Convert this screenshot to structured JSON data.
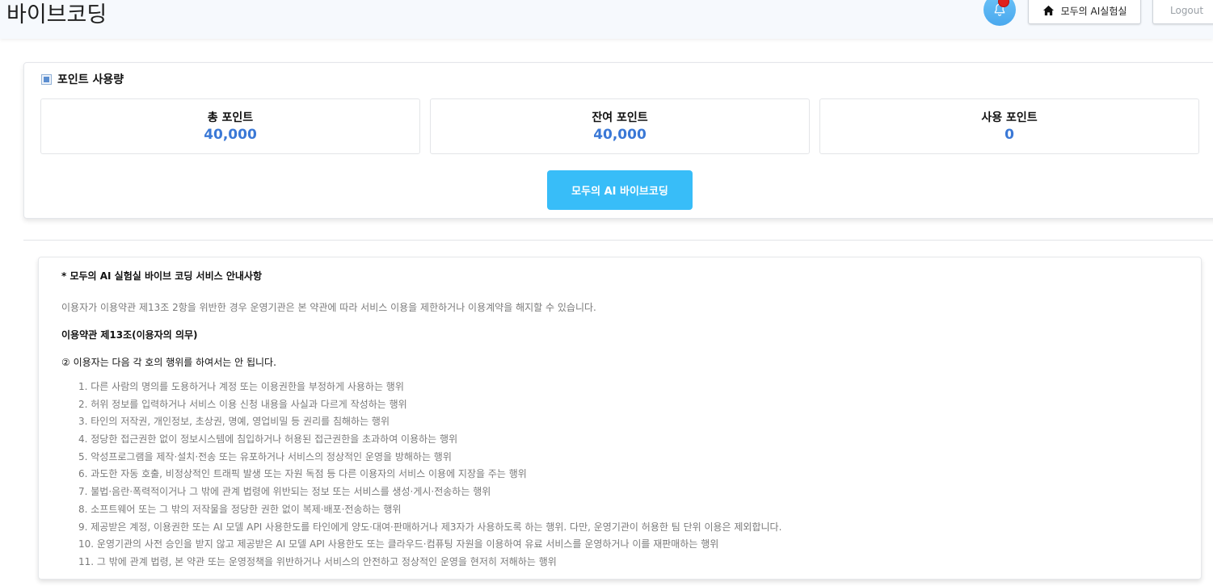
{
  "header": {
    "brand": "바이브코딩",
    "home_label": "모두의 AI실험실",
    "logout_label": "Logout"
  },
  "usage": {
    "title": "포인트 사용량",
    "stats": [
      {
        "label": "총 포인트",
        "value": "40,000"
      },
      {
        "label": "잔여 포인트",
        "value": "40,000"
      },
      {
        "label": "사용 포인트",
        "value": "0"
      }
    ],
    "cta_label": "모두의 AI 바이브코딩"
  },
  "notice": {
    "title": "* 모두의 AI 실험실 바이브 코딩 서비스 안내사항",
    "intro": "이용자가 이용약관 제13조 2항을 위반한 경우 운영기관은 본 약관에 따라 서비스 이용을 제한하거나 이용계약을 해지할 수 있습니다.",
    "subheading": "이용약관 제13조(이용자의 의무)",
    "lead": "② 이용자는 다음 각 호의 행위를 하여서는 안 됩니다.",
    "items": [
      "1. 다른 사람의 명의를 도용하거나 계정 또는 이용권한을 부정하게 사용하는 행위",
      "2. 허위 정보를 입력하거나 서비스 이용 신청 내용을 사실과 다르게 작성하는 행위",
      "3. 타인의 저작권, 개인정보, 초상권, 명예, 영업비밀 등 권리를 침해하는 행위",
      "4. 정당한 접근권한 없이 정보시스템에 침입하거나 허용된 접근권한을 초과하여 이용하는 행위",
      "5. 악성프로그램을 제작·설치·전송 또는 유포하거나 서비스의 정상적인 운영을 방해하는 행위",
      "6. 과도한 자동 호출, 비정상적인 트래픽 발생 또는 자원 독점 등 다른 이용자의 서비스 이용에 지장을 주는 행위",
      "7. 불법·음란·폭력적이거나 그 밖에 관계 법령에 위반되는 정보 또는 서비스를 생성·게시·전송하는 행위",
      "8. 소프트웨어 또는 그 밖의 저작물을 정당한 권한 없이 복제·배포·전송하는 행위",
      "9. 제공받은 계정, 이용권한 또는 AI 모델 API 사용한도를 타인에게 양도·대여·판매하거나 제3자가 사용하도록 하는 행위. 다만, 운영기관이 허용한 팀 단위 이용은 제외합니다.",
      "10. 운영기관의 사전 승인을 받지 않고 제공받은 AI 모델 API 사용한도 또는 클라우드·컴퓨팅 자원을 이용하여 유료 서비스를 운영하거나 이를 재판매하는 행위",
      "11. 그 밖에 관계 법령, 본 약관 또는 운영정책을 위반하거나 서비스의 안전하고 정상적인 운영을 현저히 저해하는 행위"
    ]
  },
  "icons": {
    "bell": "bell-icon",
    "notification_dot": "notification-dot",
    "home": "home-icon",
    "section_marker": "square-bullet-icon"
  },
  "colors": {
    "accent_blue": "#3a78d6",
    "cta": "#38bdf8",
    "notification": "#e0201c"
  }
}
